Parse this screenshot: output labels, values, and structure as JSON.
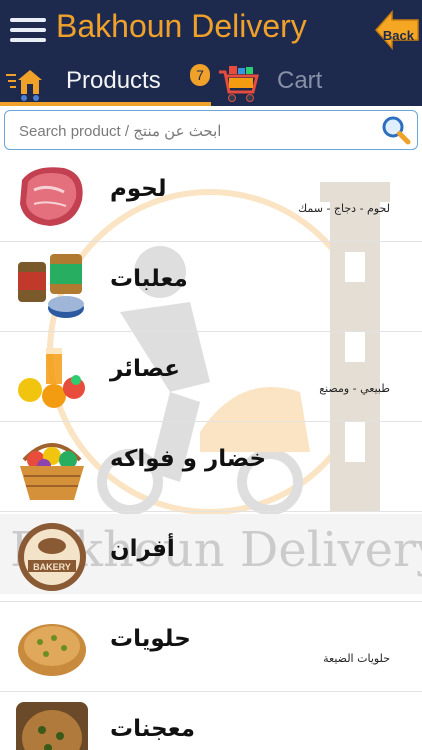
{
  "header": {
    "title": "Bakhoun Delivery",
    "back_label": "Back"
  },
  "tabs": {
    "products_label": "Products",
    "cart_label": "Cart",
    "cart_count": "7"
  },
  "search": {
    "placeholder": "Search product / ابحث عن منتج"
  },
  "categories": [
    {
      "name": "لحوم",
      "subtitle": "لحوم - دجاج - سمك",
      "icon": "meat-icon"
    },
    {
      "name": "معلبات",
      "subtitle": "",
      "icon": "canned-goods-icon"
    },
    {
      "name": "عصائر",
      "subtitle": "طبيعي - ومصنع",
      "icon": "juice-icon"
    },
    {
      "name": "خضار و فواكه",
      "subtitle": "",
      "icon": "fruit-basket-icon"
    },
    {
      "name": "أفران",
      "subtitle": "",
      "icon": "bakery-icon"
    },
    {
      "name": "حلويات",
      "subtitle": "حلويات الضيعة",
      "icon": "sweets-icon"
    },
    {
      "name": "معجنات",
      "subtitle": "",
      "icon": "pastry-icon"
    }
  ],
  "watermark": {
    "text": "Bakhoun Delivery"
  },
  "colors": {
    "bar": "#1d2a4e",
    "accent": "#f0a12a",
    "search_border": "#6aa6d9"
  }
}
